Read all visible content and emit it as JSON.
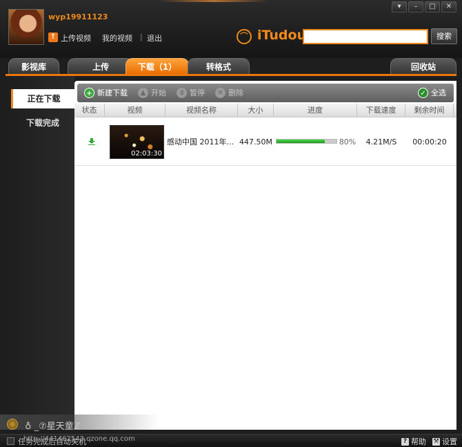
{
  "header": {
    "username": "wyp19911123",
    "upload_link": "上传视频",
    "my_videos_link": "我的视频",
    "separator": "|",
    "logout_link": "退出",
    "logo_text": "iTudou",
    "search_placeholder": "",
    "search_button": "搜索",
    "window_buttons": [
      "▾",
      "–",
      "□",
      "✕"
    ]
  },
  "tabs": [
    {
      "label": "影视库"
    },
    {
      "label": "上传"
    },
    {
      "label": "下载（1）",
      "active": true
    },
    {
      "label": "转格式"
    },
    {
      "label": "回收站"
    }
  ],
  "sidebar": {
    "items": [
      {
        "label": "正在下载",
        "active": true
      },
      {
        "label": "下载完成"
      }
    ]
  },
  "toolbar": {
    "new_download": "新建下载",
    "start": "开始",
    "pause": "暂停",
    "delete": "删除",
    "select_all": "全选"
  },
  "table": {
    "columns": [
      "状态",
      "视频",
      "视频名称",
      "大小",
      "进度",
      "下载速度",
      "剩余时间"
    ],
    "rows": [
      {
        "thumb_duration": "02:03:30",
        "name": "感动中国 2011年…",
        "size": "447.50M",
        "progress": 80,
        "progress_label": "80%",
        "speed": "4.21M/S",
        "remaining": "00:00:20"
      }
    ]
  },
  "bottom": {
    "watermark_text": "♁ _⑦星天童ℤ",
    "status_text": "任务完成后自动关机",
    "status_url": "http://441462543.qzone.qq.com",
    "help": "帮助",
    "settings": "设置"
  },
  "colors": {
    "accent": "#f08a1c",
    "progress": "#1c9a1c"
  }
}
